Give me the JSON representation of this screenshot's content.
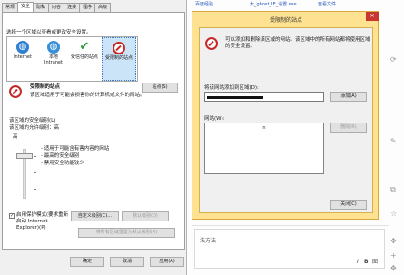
{
  "background": {
    "links": [
      "百度经验",
      "大_ghost_IE_设置.exe",
      "查看文件"
    ],
    "editor_placeholder": "法方法",
    "format_buttons": [
      "I",
      "B",
      "图"
    ]
  },
  "internet_options": {
    "tabs": [
      "常规",
      "安全",
      "隐私",
      "内容",
      "连接",
      "程序",
      "高级"
    ],
    "active_tab": 1,
    "zone_prompt": "选择一个区域以查看或更改安全设置。",
    "zones": [
      {
        "label": "Internet",
        "icon": "globe-icon"
      },
      {
        "label": "本地 Intranet",
        "icon": "intranet-globe-icon"
      },
      {
        "label": "受信任的站点",
        "icon": "checkmark-icon"
      },
      {
        "label": "受限制的站点",
        "icon": "restricted-icon"
      }
    ],
    "selected_zone": 3,
    "zone_info_title": "受限制的站点",
    "zone_info_desc": "该区域适用于可能会损害你的计算机或文件的网站。",
    "sites_button": "站点(S)",
    "security_level_group": "该区域的安全级别(L)",
    "allowed_levels": "该区域的允许级别：高",
    "level_name": "高",
    "level_bullets": [
      "- 适用于可能含有害内容的网站",
      "- 最高的安全级别",
      "- 禁用安全功能较少"
    ],
    "protected_mode_label": "启用保护模式(要求重新启动 Internet Explorer)(P)",
    "protected_mode_checked": true,
    "custom_level_button": "自定义级别(C)...",
    "default_level_button": "默认级别(D)",
    "reset_all_button": "将所有区域重置为默认级别(R)",
    "ok_button": "确定",
    "cancel_button": "取消",
    "apply_button": "应用(A)"
  },
  "restricted_sites": {
    "title": "受限制的站点",
    "close_glyph": "✕",
    "description": "可以添加和删除该区域的网站。该区域中的所有网站都将使用区域的安全设置。",
    "add_label": "将该网站添加到区域(D):",
    "add_value": "",
    "add_button": "添加(A)",
    "websites_label": "网站(W):",
    "websites": [
      "n"
    ],
    "remove_button": "删除(R)",
    "close_button": "关闭(C)"
  },
  "colors": {
    "dialog_frame": "#ffe291",
    "close_red": "#c7372f",
    "restricted_red": "#c62828",
    "selection_blue": "#cce4f7"
  }
}
